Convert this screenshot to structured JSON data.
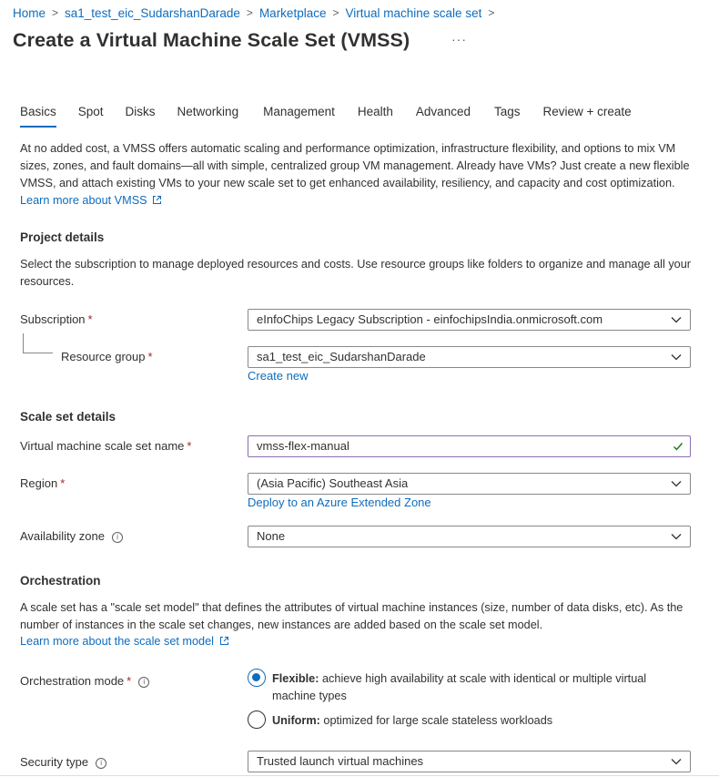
{
  "breadcrumb": {
    "items": [
      "Home",
      "sa1_test_eic_SudarshanDarade",
      "Marketplace",
      "Virtual machine scale set"
    ],
    "separator": ">"
  },
  "page": {
    "title": "Create a Virtual Machine Scale Set (VMSS)",
    "more_label": "···"
  },
  "tabs": [
    {
      "label": "Basics",
      "active": true
    },
    {
      "label": "Spot"
    },
    {
      "label": "Disks"
    },
    {
      "label": "Networking"
    },
    {
      "label": "Management"
    },
    {
      "label": "Health"
    },
    {
      "label": "Advanced"
    },
    {
      "label": "Tags"
    },
    {
      "label": "Review + create"
    }
  ],
  "intro": {
    "text": "At no added cost, a VMSS offers automatic scaling and performance optimization, infrastructure flexibility, and options to mix VM sizes, zones, and fault domains—all with simple, centralized group VM management. Already have VMs? Just create a new flexible VMSS, and attach existing VMs to your new scale set to get enhanced availability, resiliency, and capacity and cost optimization.",
    "link": "Learn more about VMSS"
  },
  "project_details": {
    "heading": "Project details",
    "description": "Select the subscription to manage deployed resources and costs. Use resource groups like folders to organize and manage all your resources.",
    "subscription_label": "Subscription",
    "subscription_value": "eInfoChips Legacy Subscription - einfochipsIndia.onmicrosoft.com",
    "resource_group_label": "Resource group",
    "resource_group_value": "sa1_test_eic_SudarshanDarade",
    "create_new_link": "Create new"
  },
  "scale_set_details": {
    "heading": "Scale set details",
    "name_label": "Virtual machine scale set name",
    "name_value": "vmss-flex-manual",
    "region_label": "Region",
    "region_value": "(Asia Pacific) Southeast Asia",
    "extended_zone_link": "Deploy to an Azure Extended Zone",
    "zone_label": "Availability zone",
    "zone_value": "None"
  },
  "orchestration": {
    "heading": "Orchestration",
    "description": "A scale set has a \"scale set model\" that defines the attributes of virtual machine instances (size, number of data disks, etc). As the number of instances in the scale set changes, new instances are added based on the scale set model.",
    "link": "Learn more about the scale set model",
    "mode_label": "Orchestration mode",
    "flexible_title": "Flexible:",
    "flexible_desc": "achieve high availability at scale with identical or multiple virtual machine types",
    "uniform_title": "Uniform:",
    "uniform_desc": "optimized for large scale stateless workloads",
    "selected": "Flexible",
    "security_type_label": "Security type",
    "security_type_value": "Trusted launch virtual machines"
  },
  "required_marker": "*",
  "info_glyph": "i",
  "colors": {
    "link": "#0f6cbd",
    "required": "#a4262c",
    "valid_check": "#107c10",
    "text": "#323130"
  },
  "icons": {
    "chevron": "chevron-down-icon",
    "external_link": "external-link-icon",
    "info": "info-icon",
    "check": "checkmark-icon"
  }
}
